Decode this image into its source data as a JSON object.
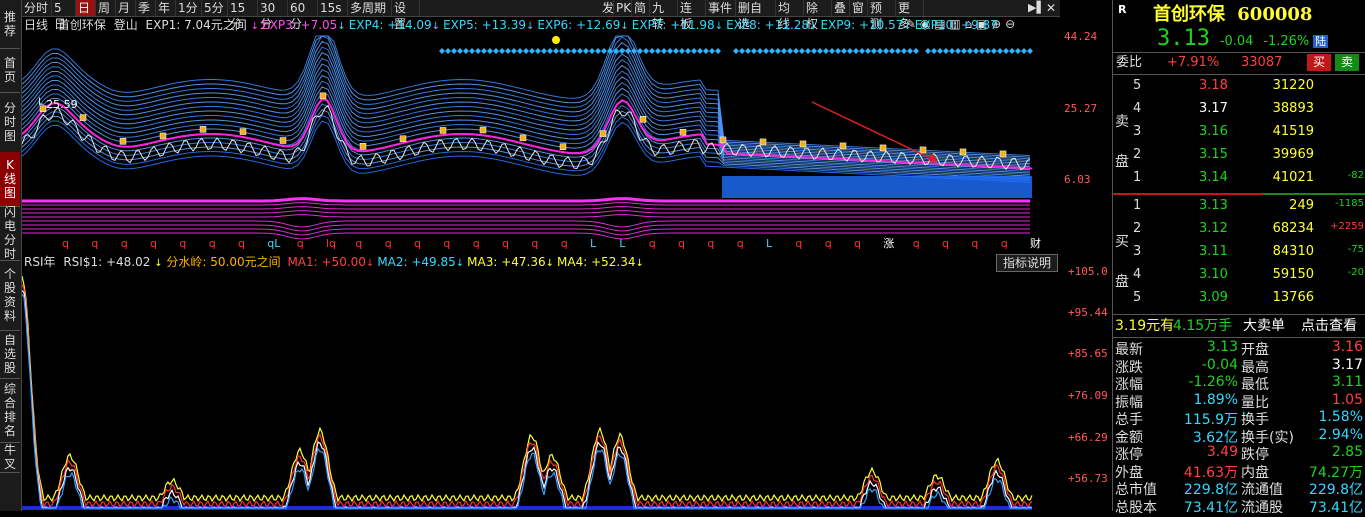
{
  "leftnav": [
    "推荐",
    "首页",
    "分时图",
    "K线图",
    "闪电分时",
    "个股资料",
    "自选股",
    "综合排名",
    "牛叉"
  ],
  "toolbar": {
    "items": [
      "分时",
      "5日",
      "日",
      "周",
      "月",
      "季",
      "年",
      "1分",
      "5分",
      "15分",
      "30分",
      "60分",
      "15s",
      "多周期",
      "设置",
      "发",
      "PK",
      "简",
      "九转",
      "连板",
      "事件",
      "删自选",
      "均线",
      "除权",
      "叠",
      "窗",
      "预测",
      "更多"
    ],
    "selected": "日"
  },
  "main_indicator": {
    "period": "日线",
    "name": "首创环保",
    "formula": "登山",
    "exp1": "EXP1: 7.04元之间",
    "exps": [
      {
        "label": "EXP3: +7.05",
        "color": "#ff4df0"
      },
      {
        "label": "EXP4: +14.09",
        "color": "#36d7ff"
      },
      {
        "label": "EXP5: +13.39",
        "color": "#36d7ff"
      },
      {
        "label": "EXP6: +12.69",
        "color": "#36d7ff"
      },
      {
        "label": "EXP7: +11.98",
        "color": "#36d7ff"
      },
      {
        "label": "EXP8: +11.28",
        "color": "#36d7ff"
      },
      {
        "label": "EXP9: +10.57",
        "color": "#36d7ff"
      },
      {
        "label": "EXP10: +9.87",
        "color": "#36d7ff"
      }
    ],
    "price_label": "25.59",
    "y_ticks": [
      "44.24",
      "25.27",
      "6.03"
    ],
    "markers": [
      "q",
      "q",
      "q",
      "q",
      "q",
      "q",
      "q",
      "qL",
      "q",
      "lq",
      "q",
      "q",
      "q",
      "q",
      "q",
      "q",
      "q",
      "q",
      "L",
      "L",
      "q",
      "q",
      "q",
      "q",
      "L",
      "q",
      "q",
      "q",
      "涨",
      "q",
      "q",
      "q",
      "q",
      "财"
    ]
  },
  "rsi_indicator": {
    "name": "RSI年",
    "rsi1": "RSI$1: +48.02",
    "divider": "分水岭: 50.00元之间",
    "ma": [
      {
        "label": "MA1: +50.00",
        "color": "#ff4040"
      },
      {
        "label": "MA2: +49.85",
        "color": "#36d7ff"
      },
      {
        "label": "MA3: +47.36",
        "color": "#ffff33"
      },
      {
        "label": "MA4: +52.34",
        "color": "#ffff33"
      }
    ],
    "explain_button": "指标说明",
    "y_ticks": [
      "+105.0",
      "+95.44",
      "+85.65",
      "+76.09",
      "+66.29",
      "+56.73"
    ]
  },
  "quote": {
    "market_tag": "R",
    "name": "首创环保",
    "code": "600008",
    "price": "3.13",
    "change": "-0.04",
    "change_pct": "-1.26%",
    "exchange_tag": "陆",
    "webi_label": "委比",
    "webi_value": "+7.91%",
    "webi_count": "33087",
    "buy_btn": "买",
    "sell_btn": "卖",
    "sell_label": [
      "卖",
      "盘"
    ],
    "buy_label": [
      "买",
      "盘"
    ],
    "asks": [
      {
        "lvl": "5",
        "price": "3.18",
        "vol": "31220",
        "chg": ""
      },
      {
        "lvl": "4",
        "price": "3.17",
        "vol": "38893",
        "chg": ""
      },
      {
        "lvl": "3",
        "price": "3.16",
        "vol": "41519",
        "chg": ""
      },
      {
        "lvl": "2",
        "price": "3.15",
        "vol": "39969",
        "chg": ""
      },
      {
        "lvl": "1",
        "price": "3.14",
        "vol": "41021",
        "chg": "-82"
      }
    ],
    "bids": [
      {
        "lvl": "1",
        "price": "3.13",
        "vol": "249",
        "chg": "-1185"
      },
      {
        "lvl": "2",
        "price": "3.12",
        "vol": "68234",
        "chg": "+2259"
      },
      {
        "lvl": "3",
        "price": "3.11",
        "vol": "84310",
        "chg": "-75"
      },
      {
        "lvl": "4",
        "price": "3.10",
        "vol": "59150",
        "chg": "-20"
      },
      {
        "lvl": "5",
        "price": "3.09",
        "vol": "13766",
        "chg": ""
      }
    ],
    "bigorder": {
      "price": "3.19元有",
      "vol": "4.15万手",
      "label": "大卖单",
      "action": "点击查看"
    },
    "stats": [
      [
        "最新",
        "3.13",
        "开盘",
        "3.16"
      ],
      [
        "涨跌",
        "-0.04",
        "最高",
        "3.17"
      ],
      [
        "涨幅",
        "-1.26%",
        "最低",
        "3.11"
      ],
      [
        "振幅",
        "1.89%",
        "量比",
        "1.05"
      ],
      [
        "总手",
        "115.9万",
        "换手",
        "1.58%"
      ],
      [
        "金额",
        "3.62亿",
        "换手(实)",
        "2.94%"
      ],
      [
        "涨停",
        "3.49",
        "跌停",
        "2.85"
      ],
      [
        "外盘",
        "41.63万",
        "内盘",
        "74.27万"
      ],
      [
        "总市值",
        "229.8亿",
        "流通值",
        "229.8亿"
      ],
      [
        "总股本",
        "73.41亿",
        "流通股",
        "73.41亿"
      ]
    ]
  }
}
